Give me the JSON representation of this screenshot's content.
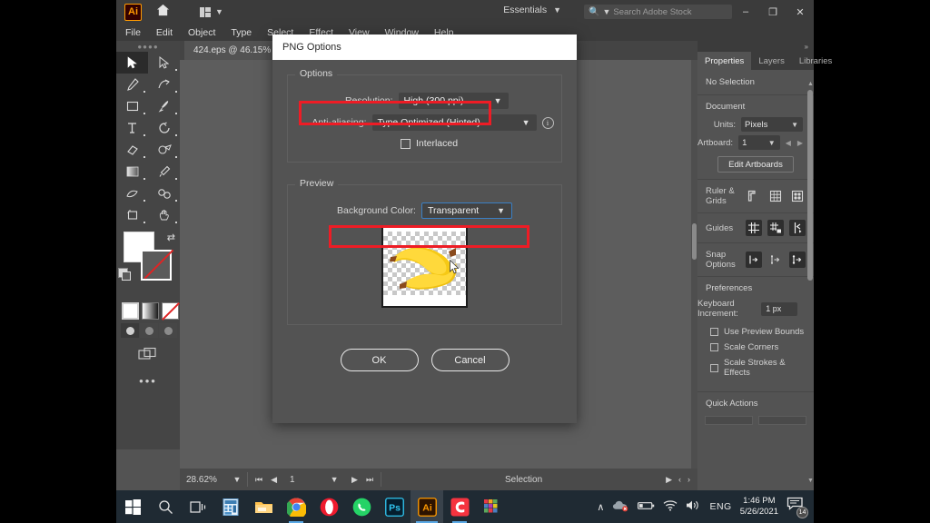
{
  "titlebar": {
    "app_icon": "illustrator-logo-icon",
    "app_icon_text": "Ai",
    "home_icon": "home-icon",
    "arrange_icon": "arrange-documents-icon",
    "workspace": "Essentials",
    "search_placeholder": "Search Adobe Stock",
    "search_value": "",
    "search_icon": "search-icon",
    "minimize": "–",
    "restore": "❐",
    "close": "✕"
  },
  "menubar": {
    "items": [
      "File",
      "Edit",
      "Object",
      "Type",
      "Select",
      "Effect",
      "View",
      "Window",
      "Help"
    ]
  },
  "document_tab": {
    "label": "424.eps @ 46.15%"
  },
  "toolbar": {
    "tools": [
      {
        "name": "selection-tool",
        "glyph": "▶",
        "selected": true
      },
      {
        "name": "direct-selection-tool",
        "glyph": "▷",
        "selected": false
      },
      {
        "name": "pen-tool",
        "glyph": "✎",
        "selected": false
      },
      {
        "name": "curvature-tool",
        "glyph": "✒",
        "selected": false
      },
      {
        "name": "rectangle-tool",
        "glyph": "▭",
        "selected": false
      },
      {
        "name": "paintbrush-tool",
        "glyph": "╱",
        "selected": false
      },
      {
        "name": "type-tool",
        "glyph": "T",
        "selected": false
      },
      {
        "name": "rotate-tool",
        "glyph": "↺",
        "selected": false
      },
      {
        "name": "eraser-tool",
        "glyph": "◇",
        "selected": false
      },
      {
        "name": "shape-builder-tool",
        "glyph": "◎",
        "selected": false
      },
      {
        "name": "gradient-tool",
        "glyph": "▨",
        "selected": false
      },
      {
        "name": "eyedropper-tool",
        "glyph": "╱",
        "selected": false
      },
      {
        "name": "free-transform-tool",
        "glyph": "✵",
        "selected": false
      },
      {
        "name": "symbol-sprayer-tool",
        "glyph": "⚇",
        "selected": false
      },
      {
        "name": "artboard-tool",
        "glyph": "◳",
        "selected": false
      },
      {
        "name": "hand-tool",
        "glyph": "✋",
        "selected": false
      }
    ],
    "fill_swatch": "fill-color-white",
    "stroke_swatch": "stroke-color-none",
    "swap_icon": "swap-fill-stroke-icon",
    "color_modes": [
      "color-swatch",
      "gradient-swatch",
      "none-swatch"
    ],
    "drawing_modes": [
      "draw-normal",
      "draw-behind",
      "draw-inside"
    ],
    "screen_mode_icon": "change-screen-mode-icon",
    "more_tools": "•••"
  },
  "statusbar": {
    "zoom": "28.62%",
    "artboard_number": "1",
    "tool_status": "Selection",
    "first_icon": "⏮",
    "prev_icon": "◀",
    "next_icon": "▶",
    "last_icon": "⏭",
    "play_icon": "▶",
    "left_chevron": "‹",
    "right_chevron": "›"
  },
  "properties_panel": {
    "collapse_icon": "collapse-panel-icon",
    "tabs": [
      {
        "label": "Properties",
        "active": true
      },
      {
        "label": "Layers",
        "active": false
      },
      {
        "label": "Libraries",
        "active": false
      }
    ],
    "selection_state": "No Selection",
    "document_section": {
      "title": "Document",
      "units_label": "Units:",
      "units_value": "Pixels",
      "artboard_label": "Artboard:",
      "artboard_value": "1",
      "prev_artboard_icon": "previous-artboard-icon",
      "next_artboard_icon": "next-artboard-icon",
      "edit_artboards_button": "Edit Artboards"
    },
    "ruler_grids": {
      "label": "Ruler & Grids",
      "icons": [
        "show-rulers-icon",
        "show-grid-icon",
        "show-transparency-grid-icon"
      ]
    },
    "guides": {
      "label": "Guides",
      "icons": [
        "show-guides-icon",
        "lock-guides-icon",
        "release-guides-icon"
      ]
    },
    "snap_options": {
      "label": "Snap Options",
      "icons": [
        "smart-guides-icon",
        "snap-to-grid-icon",
        "snap-to-point-icon"
      ]
    },
    "preferences": {
      "title": "Preferences",
      "keyboard_increment_label": "Keyboard Increment:",
      "keyboard_increment_value": "1 px",
      "checkboxes": [
        {
          "label": "Use Preview Bounds",
          "checked": false
        },
        {
          "label": "Scale Corners",
          "checked": false
        },
        {
          "label": "Scale Strokes & Effects",
          "checked": false
        }
      ]
    },
    "quick_actions": {
      "title": "Quick Actions"
    }
  },
  "dialog": {
    "title": "PNG Options",
    "options_group": {
      "label": "Options",
      "resolution_label": "Resolution:",
      "resolution_value": "High (300 ppi)",
      "antialiasing_label": "Anti-aliasing:",
      "antialiasing_value": "Type Optimized (Hinted)",
      "info_icon": "info-icon",
      "info_glyph": "i",
      "interlaced_label": "Interlaced",
      "interlaced_checked": false
    },
    "preview_group": {
      "label": "Preview",
      "background_color_label": "Background Color:",
      "background_color_value": "Transparent",
      "preview_image": "banana-artwork-thumbnail",
      "cursor": "mouse-pointer-cursor"
    },
    "ok_button": "OK",
    "cancel_button": "Cancel",
    "highlight_color": "#ee1c25",
    "focus_color": "#3b7fc4"
  },
  "taskbar": {
    "items": [
      {
        "name": "start-button",
        "label": "Windows"
      },
      {
        "name": "search-icon",
        "label": "Search"
      },
      {
        "name": "task-view-icon",
        "label": "Task View"
      },
      {
        "name": "calculator-icon",
        "label": "Calculator"
      },
      {
        "name": "file-explorer-icon",
        "label": "File Explorer"
      },
      {
        "name": "chrome-icon",
        "label": "Google Chrome"
      },
      {
        "name": "opera-icon",
        "label": "Opera"
      },
      {
        "name": "whatsapp-icon",
        "label": "WhatsApp"
      },
      {
        "name": "photoshop-icon",
        "label": "Ps"
      },
      {
        "name": "illustrator-icon",
        "label": "Ai"
      },
      {
        "name": "camtasia-icon",
        "label": "C"
      },
      {
        "name": "winrar-icon",
        "label": "WinRAR"
      }
    ],
    "tray": {
      "expand_icon": "show-hidden-icons-icon",
      "expand_glyph": "∧",
      "onedrive_icon": "onedrive-error-icon",
      "battery_icon": "battery-icon",
      "wifi_icon": "wifi-icon",
      "volume_icon": "volume-icon",
      "language": "ENG",
      "time": "1:46 PM",
      "date": "5/26/2021",
      "notifications_icon": "notifications-icon",
      "notifications_count": "14"
    }
  }
}
